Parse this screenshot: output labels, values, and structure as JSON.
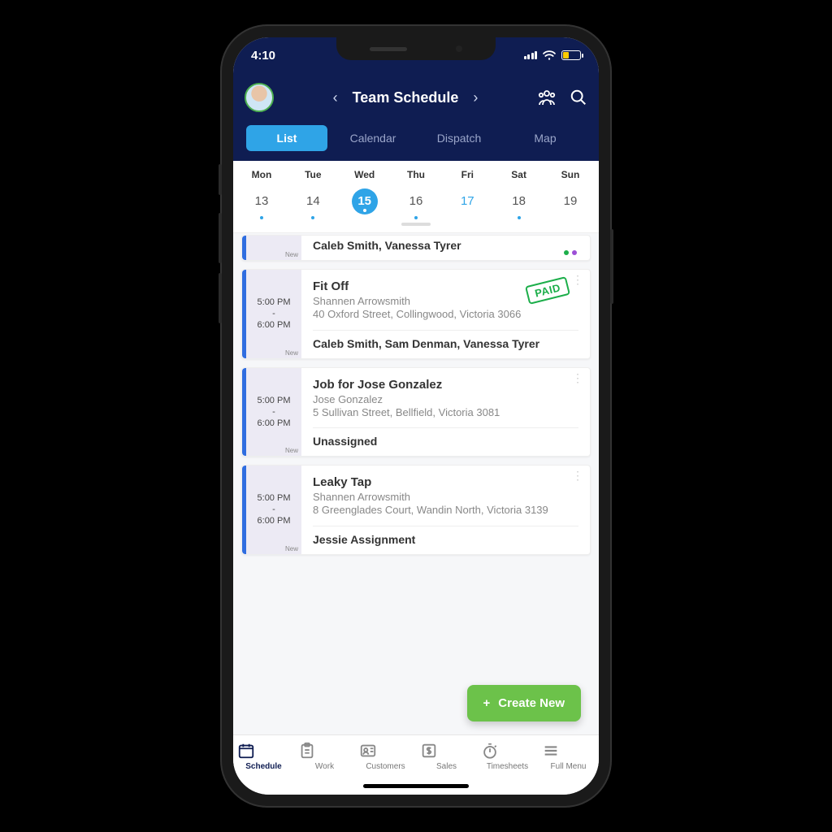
{
  "status": {
    "time": "4:10"
  },
  "header": {
    "title": "Team Schedule",
    "tabs": [
      {
        "label": "List",
        "active": true
      },
      {
        "label": "Calendar",
        "active": false
      },
      {
        "label": "Dispatch",
        "active": false
      },
      {
        "label": "Map",
        "active": false
      }
    ]
  },
  "days": [
    {
      "label": "Mon",
      "num": "13"
    },
    {
      "label": "Tue",
      "num": "14"
    },
    {
      "label": "Wed",
      "num": "15",
      "today": true
    },
    {
      "label": "Thu",
      "num": "16"
    },
    {
      "label": "Fri",
      "num": "17",
      "accent": true
    },
    {
      "label": "Sat",
      "num": "18"
    },
    {
      "label": "Sun",
      "num": "19"
    }
  ],
  "partial_card": {
    "assignees": "Caleb Smith, Vanessa Tyrer",
    "status_tag": "New"
  },
  "jobs": [
    {
      "time_start": "5:00 PM",
      "time_end": "6:00 PM",
      "status_tag": "New",
      "title": "Fit Off",
      "customer": "Shannen Arrowsmith",
      "address": "40 Oxford Street, Collingwood, Victoria 3066",
      "assignees": "Caleb Smith, Sam Denman, Vanessa Tyrer",
      "paid": true
    },
    {
      "time_start": "5:00 PM",
      "time_end": "6:00 PM",
      "status_tag": "New",
      "title": "Job for Jose Gonzalez",
      "customer": "Jose Gonzalez",
      "address": "5 Sullivan Street, Bellfield, Victoria 3081",
      "assignees": "Unassigned",
      "paid": false
    },
    {
      "time_start": "5:00 PM",
      "time_end": "6:00 PM",
      "status_tag": "New",
      "title": "Leaky Tap",
      "customer": "Shannen Arrowsmith",
      "address": "8 Greenglades Court, Wandin North, Victoria 3139",
      "assignees": "Jessie Assignment",
      "paid": false
    }
  ],
  "fab": {
    "label": "Create New"
  },
  "paid_label": "PAID",
  "bottom_nav": [
    {
      "label": "Schedule",
      "active": true
    },
    {
      "label": "Work"
    },
    {
      "label": "Customers"
    },
    {
      "label": "Sales"
    },
    {
      "label": "Timesheets"
    },
    {
      "label": "Full Menu"
    }
  ]
}
